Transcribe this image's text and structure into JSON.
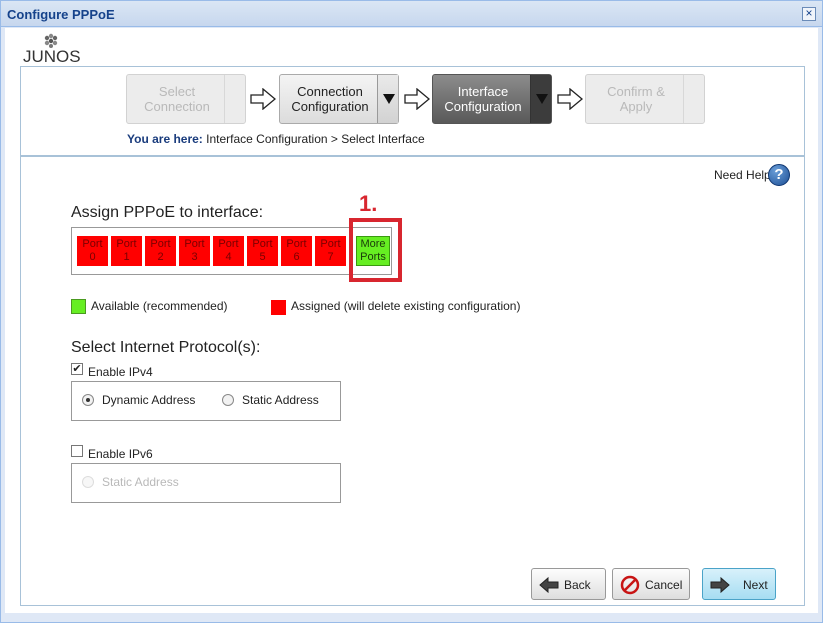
{
  "window": {
    "title": "Configure PPPoE",
    "close_glyph": "×"
  },
  "logo": {
    "text": "JUNOS"
  },
  "steps": [
    {
      "label_line1": "Select",
      "label_line2": "Connection",
      "state": "disabled"
    },
    {
      "label_line1": "Connection",
      "label_line2": "Configuration",
      "state": "done"
    },
    {
      "label_line1": "Interface",
      "label_line2": "Configuration",
      "state": "active"
    },
    {
      "label_line1": "Confirm &",
      "label_line2": "Apply",
      "state": "disabled"
    }
  ],
  "breadcrumb": {
    "prefix": "You are here:",
    "path": "Interface Configuration > Select Interface"
  },
  "help": {
    "label": "Need Help",
    "icon": "question-icon",
    "glyph": "?"
  },
  "assign": {
    "heading": "Assign PPPoE to interface:",
    "ports": [
      {
        "line1": "Port",
        "line2": "0"
      },
      {
        "line1": "Port",
        "line2": "1"
      },
      {
        "line1": "Port",
        "line2": "2"
      },
      {
        "line1": "Port",
        "line2": "3"
      },
      {
        "line1": "Port",
        "line2": "4"
      },
      {
        "line1": "Port",
        "line2": "5"
      },
      {
        "line1": "Port",
        "line2": "6"
      },
      {
        "line1": "Port",
        "line2": "7"
      }
    ],
    "more": {
      "line1": "More",
      "line2": "Ports"
    },
    "annotation": "1."
  },
  "legend": {
    "available": "Available (recommended)",
    "assigned": "Assigned (will delete existing configuration)",
    "available_color": "#66ee22",
    "assigned_color": "#ff0000"
  },
  "protocols": {
    "heading": "Select Internet Protocol(s):",
    "ipv4": {
      "label": "Enable IPv4",
      "checked": true,
      "dynamic": "Dynamic Address",
      "static": "Static Address",
      "selected": "dynamic"
    },
    "ipv6": {
      "label": "Enable IPv6",
      "checked": false,
      "static": "Static Address"
    }
  },
  "buttons": {
    "back": "Back",
    "cancel": "Cancel",
    "next": "Next"
  }
}
